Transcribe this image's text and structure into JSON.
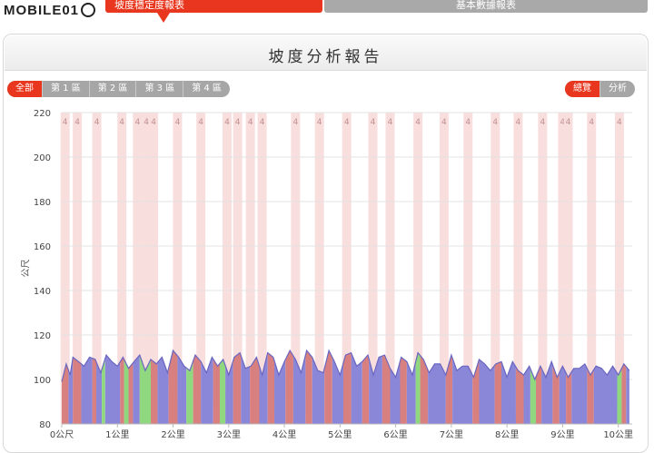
{
  "header": {
    "logo_text": "MOBILE01",
    "tabs": [
      {
        "label": "坡度穩定度報表",
        "active": true
      },
      {
        "label": "基本數據報表",
        "active": false
      }
    ]
  },
  "panel": {
    "title": "坡度分析報告"
  },
  "filters": {
    "zones": [
      "全部",
      "第 1 區",
      "第 2 區",
      "第 3 區",
      "第 4 區"
    ],
    "active_zone": "全部",
    "views": [
      "總覽",
      "分析"
    ],
    "active_view": "總覽"
  },
  "colors": {
    "accent": "#e8371e",
    "tab_inactive": "#a9a9a9",
    "series_flat": "#8a86d8",
    "series_climb": "#d88080",
    "series_descent": "#90d880",
    "band": "#f9dede",
    "band_label": "#c09090"
  },
  "chart_data": {
    "type": "area",
    "title": "",
    "ylabel": "公尺",
    "xlabel": "",
    "ylim": [
      80,
      220
    ],
    "xlim": [
      0,
      10.25
    ],
    "yticks": [
      80,
      100,
      120,
      140,
      160,
      180,
      200,
      220
    ],
    "xticks": [
      {
        "value": 0,
        "label": "0公尺"
      },
      {
        "value": 1,
        "label": "1公里"
      },
      {
        "value": 2,
        "label": "2公里"
      },
      {
        "value": 3,
        "label": "3公里"
      },
      {
        "value": 4,
        "label": "4公里"
      },
      {
        "value": 5,
        "label": "5公里"
      },
      {
        "value": 6,
        "label": "6公里"
      },
      {
        "value": 7,
        "label": "7公里"
      },
      {
        "value": 8,
        "label": "8公里"
      },
      {
        "value": 9,
        "label": "9公里"
      },
      {
        "value": 10,
        "label": "10公里"
      }
    ],
    "grid": true,
    "series": [
      {
        "x": [
          0,
          0.08,
          0.15,
          0.2,
          0.3,
          0.4,
          0.5,
          0.6,
          0.7,
          0.8,
          0.9,
          1.0,
          1.1,
          1.2,
          1.3,
          1.4,
          1.5,
          1.6,
          1.7,
          1.8,
          1.9,
          2.0,
          2.1,
          2.2,
          2.3,
          2.4,
          2.5,
          2.6,
          2.7,
          2.8,
          2.9,
          3.0,
          3.1,
          3.2,
          3.3,
          3.4,
          3.5,
          3.6,
          3.7,
          3.8,
          3.9,
          4.0,
          4.1,
          4.2,
          4.3,
          4.4,
          4.5,
          4.6,
          4.7,
          4.8,
          4.9,
          5.0,
          5.1,
          5.2,
          5.3,
          5.4,
          5.5,
          5.6,
          5.7,
          5.8,
          5.9,
          6.0,
          6.1,
          6.2,
          6.3,
          6.4,
          6.5,
          6.6,
          6.7,
          6.8,
          6.9,
          7.0,
          7.1,
          7.2,
          7.3,
          7.4,
          7.5,
          7.6,
          7.7,
          7.8,
          7.9,
          8.0,
          8.1,
          8.2,
          8.3,
          8.4,
          8.5,
          8.6,
          8.7,
          8.8,
          8.9,
          9.0,
          9.1,
          9.2,
          9.3,
          9.4,
          9.5,
          9.6,
          9.7,
          9.8,
          9.9,
          10.0,
          10.1,
          10.2
        ],
        "y": [
          99,
          107,
          102,
          110,
          108,
          106,
          110,
          109,
          103,
          111,
          108,
          106,
          110,
          105,
          108,
          111,
          104,
          109,
          107,
          110,
          103,
          113,
          110,
          106,
          104,
          111,
          108,
          103,
          110,
          106,
          109,
          102,
          110,
          112,
          105,
          106,
          110,
          102,
          112,
          110,
          102,
          108,
          113,
          109,
          103,
          113,
          110,
          104,
          103,
          113,
          108,
          102,
          111,
          112,
          106,
          108,
          111,
          102,
          110,
          111,
          105,
          101,
          110,
          108,
          102,
          112,
          109,
          103,
          107,
          107,
          102,
          111,
          104,
          106,
          106,
          101,
          109,
          107,
          104,
          107,
          108,
          101,
          108,
          104,
          102,
          106,
          100,
          106,
          101,
          108,
          101,
          106,
          101,
          105,
          105,
          107,
          102,
          106,
          105,
          102,
          106,
          102,
          107,
          104
        ]
      }
    ],
    "segments": [
      {
        "from": 0.0,
        "to": 0.12,
        "kind": "climb"
      },
      {
        "from": 0.12,
        "to": 0.2,
        "kind": "flat"
      },
      {
        "from": 0.2,
        "to": 0.35,
        "kind": "climb"
      },
      {
        "from": 0.35,
        "to": 0.55,
        "kind": "flat"
      },
      {
        "from": 0.55,
        "to": 0.62,
        "kind": "climb"
      },
      {
        "from": 0.62,
        "to": 0.72,
        "kind": "flat"
      },
      {
        "from": 0.72,
        "to": 0.78,
        "kind": "descent"
      },
      {
        "from": 0.78,
        "to": 1.05,
        "kind": "flat"
      },
      {
        "from": 1.05,
        "to": 1.12,
        "kind": "climb"
      },
      {
        "from": 1.12,
        "to": 1.2,
        "kind": "descent"
      },
      {
        "from": 1.2,
        "to": 1.28,
        "kind": "climb"
      },
      {
        "from": 1.28,
        "to": 1.4,
        "kind": "flat"
      },
      {
        "from": 1.4,
        "to": 1.6,
        "kind": "descent"
      },
      {
        "from": 1.6,
        "to": 1.72,
        "kind": "climb"
      },
      {
        "from": 1.72,
        "to": 1.92,
        "kind": "flat"
      },
      {
        "from": 1.92,
        "to": 2.08,
        "kind": "climb"
      },
      {
        "from": 2.08,
        "to": 2.24,
        "kind": "flat"
      },
      {
        "from": 2.24,
        "to": 2.36,
        "kind": "descent"
      },
      {
        "from": 2.36,
        "to": 2.5,
        "kind": "climb"
      },
      {
        "from": 2.5,
        "to": 2.72,
        "kind": "flat"
      },
      {
        "from": 2.72,
        "to": 2.84,
        "kind": "climb"
      },
      {
        "from": 2.84,
        "to": 2.94,
        "kind": "descent"
      },
      {
        "from": 2.94,
        "to": 3.08,
        "kind": "flat"
      },
      {
        "from": 3.08,
        "to": 3.22,
        "kind": "climb"
      },
      {
        "from": 3.22,
        "to": 3.38,
        "kind": "flat"
      },
      {
        "from": 3.38,
        "to": 3.55,
        "kind": "climb"
      },
      {
        "from": 3.55,
        "to": 3.7,
        "kind": "flat"
      },
      {
        "from": 3.7,
        "to": 3.82,
        "kind": "climb"
      },
      {
        "from": 3.82,
        "to": 4.02,
        "kind": "flat"
      },
      {
        "from": 4.02,
        "to": 4.16,
        "kind": "climb"
      },
      {
        "from": 4.16,
        "to": 4.38,
        "kind": "flat"
      },
      {
        "from": 4.38,
        "to": 4.5,
        "kind": "climb"
      },
      {
        "from": 4.5,
        "to": 4.72,
        "kind": "flat"
      },
      {
        "from": 4.72,
        "to": 4.86,
        "kind": "climb"
      },
      {
        "from": 4.86,
        "to": 5.06,
        "kind": "flat"
      },
      {
        "from": 5.06,
        "to": 5.2,
        "kind": "climb"
      },
      {
        "from": 5.2,
        "to": 5.4,
        "kind": "flat"
      },
      {
        "from": 5.4,
        "to": 5.52,
        "kind": "climb"
      },
      {
        "from": 5.52,
        "to": 5.76,
        "kind": "flat"
      },
      {
        "from": 5.76,
        "to": 5.9,
        "kind": "climb"
      },
      {
        "from": 5.9,
        "to": 6.08,
        "kind": "flat"
      },
      {
        "from": 6.08,
        "to": 6.2,
        "kind": "climb"
      },
      {
        "from": 6.2,
        "to": 6.36,
        "kind": "flat"
      },
      {
        "from": 6.36,
        "to": 6.44,
        "kind": "descent"
      },
      {
        "from": 6.44,
        "to": 6.58,
        "kind": "climb"
      },
      {
        "from": 6.58,
        "to": 6.9,
        "kind": "flat"
      },
      {
        "from": 6.9,
        "to": 7.02,
        "kind": "climb"
      },
      {
        "from": 7.02,
        "to": 7.38,
        "kind": "flat"
      },
      {
        "from": 7.38,
        "to": 7.5,
        "kind": "climb"
      },
      {
        "from": 7.5,
        "to": 7.78,
        "kind": "flat"
      },
      {
        "from": 7.78,
        "to": 7.9,
        "kind": "climb"
      },
      {
        "from": 7.9,
        "to": 8.16,
        "kind": "flat"
      },
      {
        "from": 8.16,
        "to": 8.3,
        "kind": "climb"
      },
      {
        "from": 8.3,
        "to": 8.42,
        "kind": "flat"
      },
      {
        "from": 8.42,
        "to": 8.52,
        "kind": "descent"
      },
      {
        "from": 8.52,
        "to": 8.62,
        "kind": "climb"
      },
      {
        "from": 8.62,
        "to": 8.82,
        "kind": "flat"
      },
      {
        "from": 8.82,
        "to": 8.94,
        "kind": "climb"
      },
      {
        "from": 8.94,
        "to": 9.06,
        "kind": "flat"
      },
      {
        "from": 9.06,
        "to": 9.16,
        "kind": "climb"
      },
      {
        "from": 9.16,
        "to": 9.44,
        "kind": "flat"
      },
      {
        "from": 9.44,
        "to": 9.56,
        "kind": "climb"
      },
      {
        "from": 9.56,
        "to": 9.98,
        "kind": "flat"
      },
      {
        "from": 9.98,
        "to": 10.06,
        "kind": "descent"
      },
      {
        "from": 10.06,
        "to": 10.14,
        "kind": "climb"
      },
      {
        "from": 10.14,
        "to": 10.2,
        "kind": "flat"
      }
    ],
    "bands": [
      {
        "x": 0.06,
        "label": "4"
      },
      {
        "x": 0.28,
        "label": "4"
      },
      {
        "x": 0.63,
        "label": "4"
      },
      {
        "x": 1.08,
        "label": "4"
      },
      {
        "x": 1.36,
        "label": "4"
      },
      {
        "x": 1.52,
        "label": "4"
      },
      {
        "x": 1.65,
        "label": "4"
      },
      {
        "x": 2.08,
        "label": "4"
      },
      {
        "x": 2.5,
        "label": "4"
      },
      {
        "x": 2.97,
        "label": "4"
      },
      {
        "x": 3.16,
        "label": "4"
      },
      {
        "x": 3.39,
        "label": "4"
      },
      {
        "x": 3.6,
        "label": "4"
      },
      {
        "x": 4.2,
        "label": "4"
      },
      {
        "x": 4.63,
        "label": "4"
      },
      {
        "x": 5.12,
        "label": "4"
      },
      {
        "x": 5.59,
        "label": "4"
      },
      {
        "x": 5.9,
        "label": "4"
      },
      {
        "x": 6.4,
        "label": "4"
      },
      {
        "x": 6.87,
        "label": "4"
      },
      {
        "x": 7.3,
        "label": "4"
      },
      {
        "x": 7.79,
        "label": "4"
      },
      {
        "x": 8.2,
        "label": "4"
      },
      {
        "x": 8.64,
        "label": "4"
      },
      {
        "x": 9.0,
        "label": "4"
      },
      {
        "x": 9.1,
        "label": "4"
      },
      {
        "x": 9.52,
        "label": "4"
      },
      {
        "x": 10.02,
        "label": "4"
      }
    ]
  }
}
